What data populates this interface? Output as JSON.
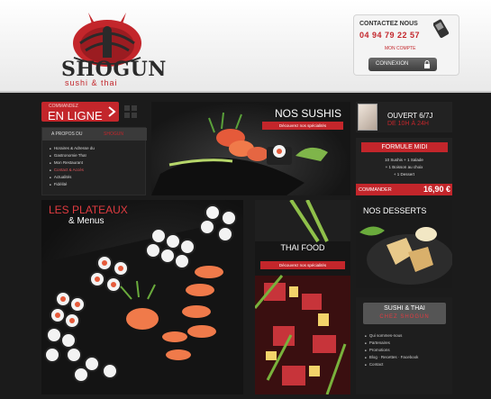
{
  "header": {
    "logo": {
      "title": "SHOGUN",
      "subtitle": "sushi & thai"
    },
    "contact": {
      "label": "CONTACTEZ NOUS",
      "phone": "04 94 79 22 57"
    },
    "account_link": "MON COMPTE",
    "login_button": "CONNEXION"
  },
  "order_button": {
    "small": "COMMANDEZ",
    "big": "EN LIGNE"
  },
  "about": {
    "title": "A PROPOS DU",
    "brand": "SHOGUN",
    "items": [
      {
        "label": "Horaires & Adresse du",
        "active": false
      },
      {
        "label": "Gastronomie Thaï",
        "active": false
      },
      {
        "label": "Mon Restaurant",
        "active": false
      },
      {
        "label": "Contact & Accès",
        "active": true
      },
      {
        "label": "Actualités",
        "active": false
      },
      {
        "label": "Fidélité",
        "active": false
      }
    ]
  },
  "sushi_promo": {
    "title": "NOS SUSHIS",
    "subtitle": "Découvrez nos spécialités"
  },
  "opening": {
    "days": "OUVERT 6/7J",
    "hours": "DE 10H À 24H"
  },
  "formula": {
    "title": "FORMULE MIDI",
    "lines": [
      "10 Sushis + 1 Salade",
      "+ 1 Boisson au choix",
      "+ 1 Dessert"
    ],
    "order_label": "COMMANDER",
    "price": "16,90 €"
  },
  "plateaux": {
    "title": "LES PLATEAUX",
    "subtitle": "& Menus"
  },
  "thai_food": {
    "title": "THAI FOOD",
    "subtitle": "Découvrez nos spécialités"
  },
  "desserts": {
    "title": "NOS DESSERTS"
  },
  "info": {
    "title": "SUSHI & THAI",
    "brand": "CHEZ SHOGUN",
    "items": [
      "Qui sommes-nous",
      "Partenaires",
      "Promotions",
      "Blog · Recettes · Facebook",
      "Contact"
    ]
  },
  "colors": {
    "accent_red": "#c3262b",
    "panel_dark": "#1b1b1b",
    "header_bg": "#f2f2f2"
  },
  "icons": [
    "shogun-logo-emblem",
    "phone-icon",
    "lock-icon",
    "arrow-right-icon",
    "grid-icon"
  ]
}
